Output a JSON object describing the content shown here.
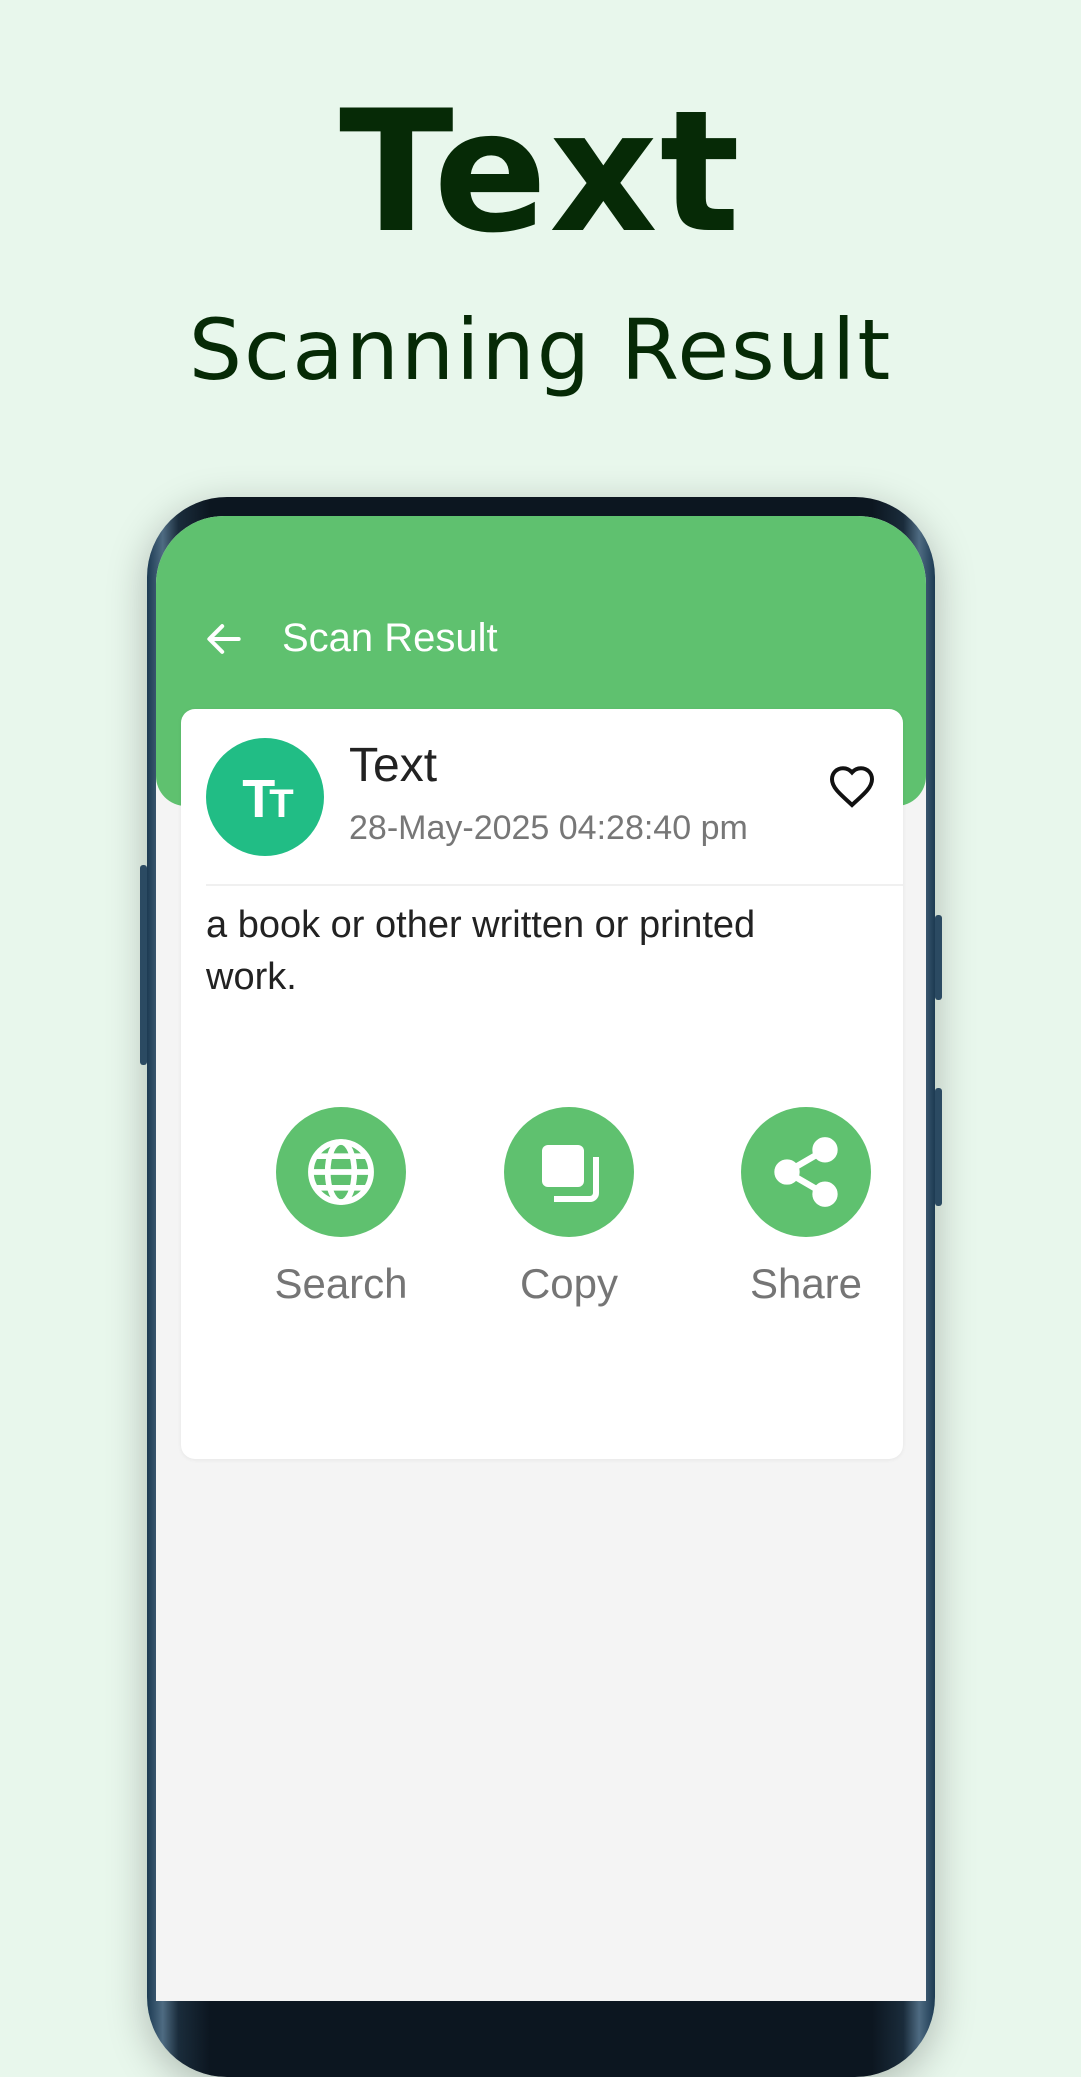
{
  "promo": {
    "headline": "Text",
    "subheadline": "Scanning Result"
  },
  "appbar": {
    "back_icon": "arrow-left-icon",
    "title": "Scan Result"
  },
  "result": {
    "avatar_icon": "text-size-icon",
    "avatar_glyph_big": "T",
    "avatar_glyph_small": "T",
    "type": "Text",
    "datetime": "28-May-2025 04:28:40 pm",
    "favorite_icon": "heart-outline-icon",
    "content": "a book or other written or printed work."
  },
  "actions": [
    {
      "icon": "globe-icon",
      "label": "Search"
    },
    {
      "icon": "copy-icon",
      "label": "Copy"
    },
    {
      "icon": "share-icon",
      "label": "Share"
    }
  ],
  "colors": {
    "background": "#e8f7ec",
    "headline": "#062a06",
    "accent": "#5fc16f",
    "avatar": "#21bd85"
  }
}
